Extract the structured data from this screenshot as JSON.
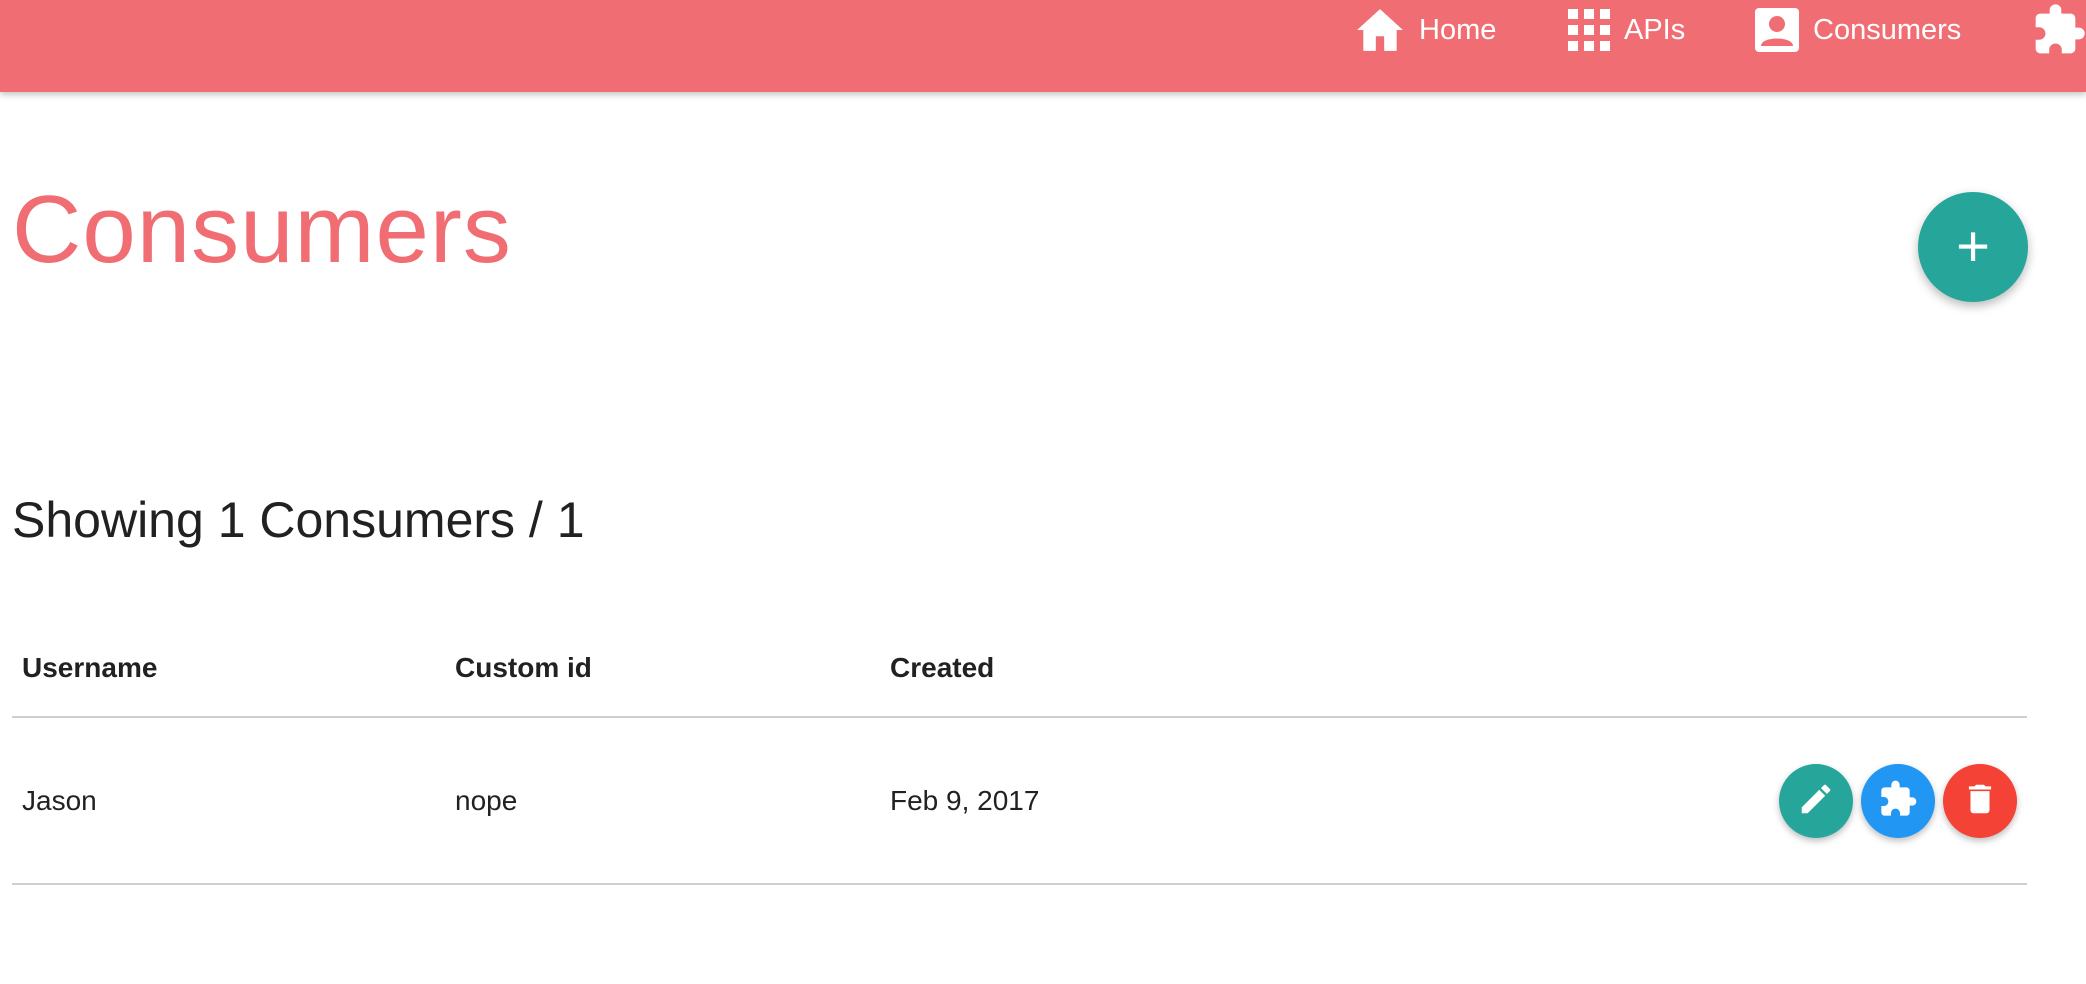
{
  "nav": {
    "home": {
      "label": "Home",
      "icon": "home-icon"
    },
    "apis": {
      "label": "APIs",
      "icon": "grid-icon"
    },
    "consumers": {
      "label": "Consumers",
      "icon": "account-box-icon"
    },
    "plugins": {
      "label": "",
      "icon": "puzzle-icon"
    }
  },
  "page": {
    "title": "Consumers",
    "add_button_label": "+",
    "showing_text": "Showing 1 Consumers / 1"
  },
  "table": {
    "headers": {
      "username": "Username",
      "custom_id": "Custom id",
      "created": "Created"
    },
    "rows": [
      {
        "username": "Jason",
        "custom_id": "nope",
        "created": "Feb 9, 2017"
      }
    ],
    "row_actions": [
      "edit",
      "plugins",
      "delete"
    ]
  },
  "colors": {
    "primary": "#f06e73",
    "teal": "#26a69a",
    "blue": "#2196f3",
    "red": "#f44336"
  }
}
